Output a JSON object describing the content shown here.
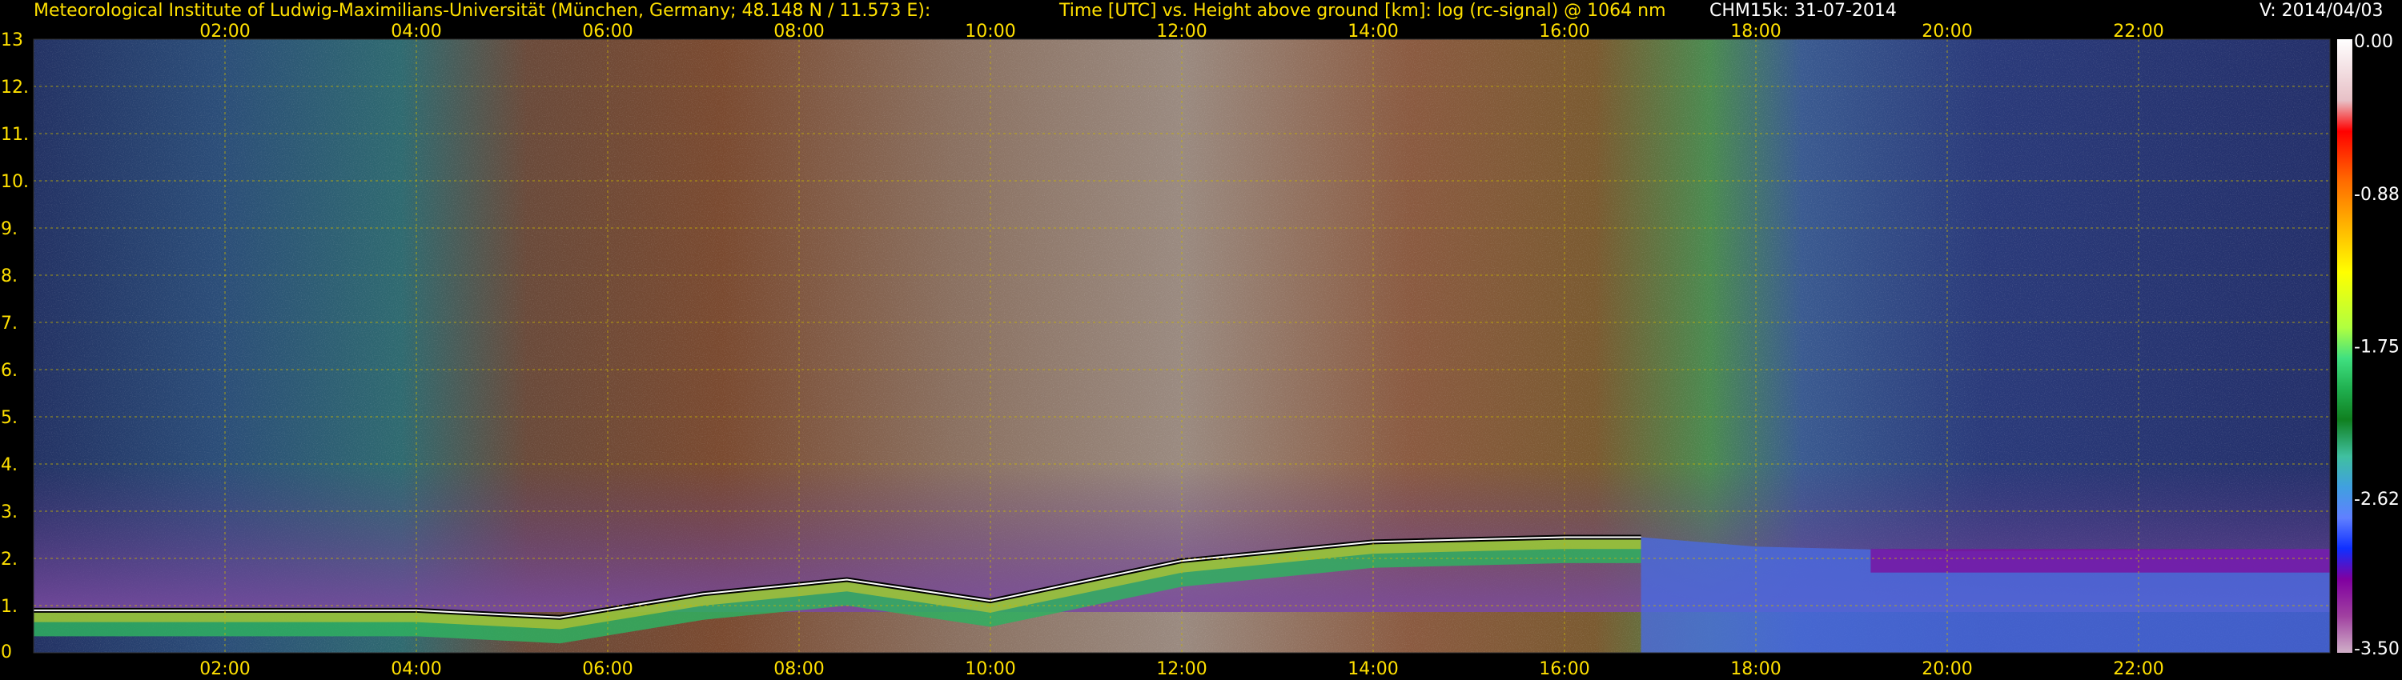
{
  "header": {
    "institute": "Meteorological Institute of Ludwig-Maximilians-Universität (München, Germany; 48.148 N / 11.573 E):",
    "description": "Time [UTC] vs. Height above ground [km]: log (rc-signal) @ 1064 nm",
    "instrument": "CHM15k: 31-07-2014",
    "version": "V: 2014/04/03"
  },
  "colors": {
    "header_text": "#ffe000",
    "grid": "#c8b400",
    "background": "#000000"
  },
  "chart_data": {
    "type": "heatmap",
    "title": "Time [UTC] vs. Height above ground [km]: log (rc-signal) @ 1064 nm",
    "xlabel": "Time [UTC]",
    "ylabel": "Height above ground [km]",
    "x_range_hours": [
      0,
      24
    ],
    "ylim": [
      0,
      13
    ],
    "x_ticks": [
      "02:00",
      "04:00",
      "06:00",
      "08:00",
      "10:00",
      "12:00",
      "14:00",
      "16:00",
      "18:00",
      "20:00",
      "22:00"
    ],
    "x_tick_hours": [
      2,
      4,
      6,
      8,
      10,
      12,
      14,
      16,
      18,
      20,
      22
    ],
    "y_ticks": [
      "0",
      "1.",
      "2.",
      "3.",
      "4.",
      "5.",
      "6.",
      "7.",
      "8.",
      "9.",
      "10.",
      "11.",
      "12.",
      "13"
    ],
    "y_tick_values": [
      0,
      1,
      2,
      3,
      4,
      5,
      6,
      7,
      8,
      9,
      10,
      11,
      12,
      13
    ],
    "grid": true,
    "colorbar": {
      "labels": [
        "0.00",
        "-0.88",
        "-1.75",
        "-2.62",
        "-3.50"
      ],
      "values": [
        0.0,
        -0.88,
        -1.75,
        -2.62,
        -3.5
      ],
      "range": [
        -3.5,
        0.0
      ]
    },
    "boundary_layer_top_km": [
      {
        "hour": 0.0,
        "km": 0.9
      },
      {
        "hour": 2.0,
        "km": 0.9
      },
      {
        "hour": 4.0,
        "km": 0.9
      },
      {
        "hour": 5.5,
        "km": 0.75
      },
      {
        "hour": 7.0,
        "km": 1.25
      },
      {
        "hour": 8.5,
        "km": 1.55
      },
      {
        "hour": 10.0,
        "km": 1.1
      },
      {
        "hour": 12.0,
        "km": 1.95
      },
      {
        "hour": 14.0,
        "km": 2.35
      },
      {
        "hour": 16.0,
        "km": 2.45
      },
      {
        "hour": 16.8,
        "km": 2.45
      }
    ]
  }
}
